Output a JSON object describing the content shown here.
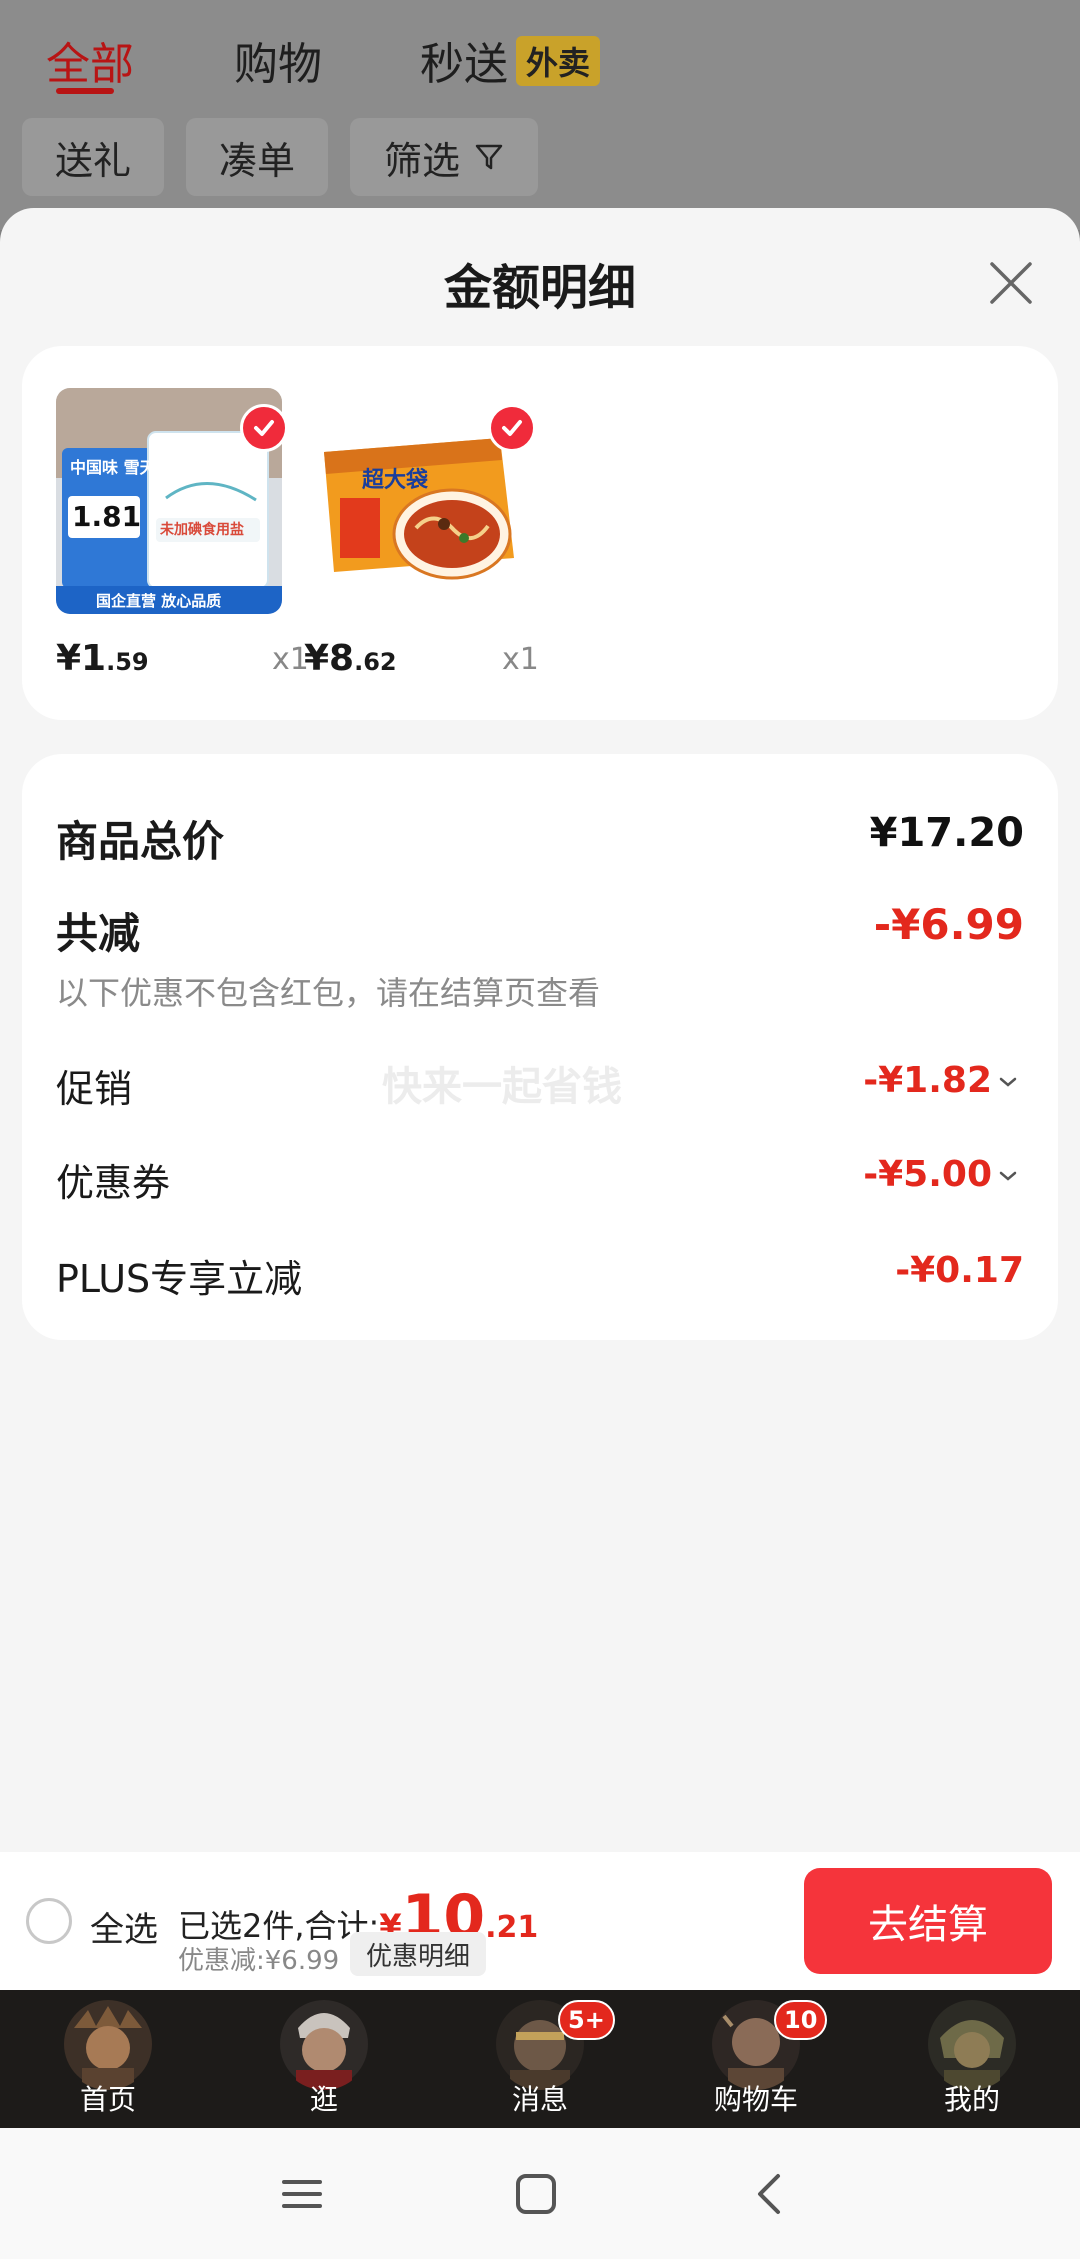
{
  "top": {
    "tabs": [
      {
        "label": "全部"
      },
      {
        "label": "购物"
      },
      {
        "label": "秒送"
      }
    ],
    "waimai_badge": "外卖",
    "filters": [
      {
        "label": "送礼"
      },
      {
        "label": "凑单"
      },
      {
        "label": "筛选"
      }
    ]
  },
  "sheet": {
    "title": "金额明细",
    "products": [
      {
        "price_int": "¥1",
        "price_dec": ".59",
        "qty": "x1",
        "image": "salt-package-image",
        "img_text_brand": "中国味 雪天盐",
        "img_text_price": "1.81",
        "img_text_bag": "未加碘食用盐",
        "img_text_footer": "国企直营 放心品质"
      },
      {
        "price_int": "¥8",
        "price_dec": ".62",
        "qty": "x1",
        "image": "instant-noodle-package-image",
        "img_text_brand": "超大袋"
      }
    ],
    "summary": {
      "total_label": "商品总价",
      "total_value": "¥17.20",
      "reduce_label": "共减",
      "reduce_value": "-¥6.99",
      "note": "以下优惠不包含红包，请在结算页查看",
      "watermark": "快来一起省钱",
      "rows": [
        {
          "label": "促销",
          "value": "-¥1.82"
        },
        {
          "label": "优惠券",
          "value": "-¥5.00"
        },
        {
          "label": "PLUS专享立减",
          "value": "-¥0.17"
        }
      ]
    }
  },
  "checkout": {
    "select_all": "全选",
    "selected_text": "已选2件,合计:",
    "total_yen": "¥",
    "total_int": "10",
    "total_dec": ".21",
    "discount_text": "优惠减:¥6.99",
    "detail_chip": "优惠明细",
    "checkout_button": "去结算"
  },
  "tabbar": {
    "items": [
      {
        "label": "首页"
      },
      {
        "label": "逛"
      },
      {
        "label": "消息",
        "badge": "5+"
      },
      {
        "label": "购物车",
        "badge": "10"
      },
      {
        "label": "我的"
      }
    ]
  },
  "colors": {
    "accent_red": "#e3281d",
    "button_red": "#f5343b",
    "tabbar_bg": "#1d1b19"
  }
}
